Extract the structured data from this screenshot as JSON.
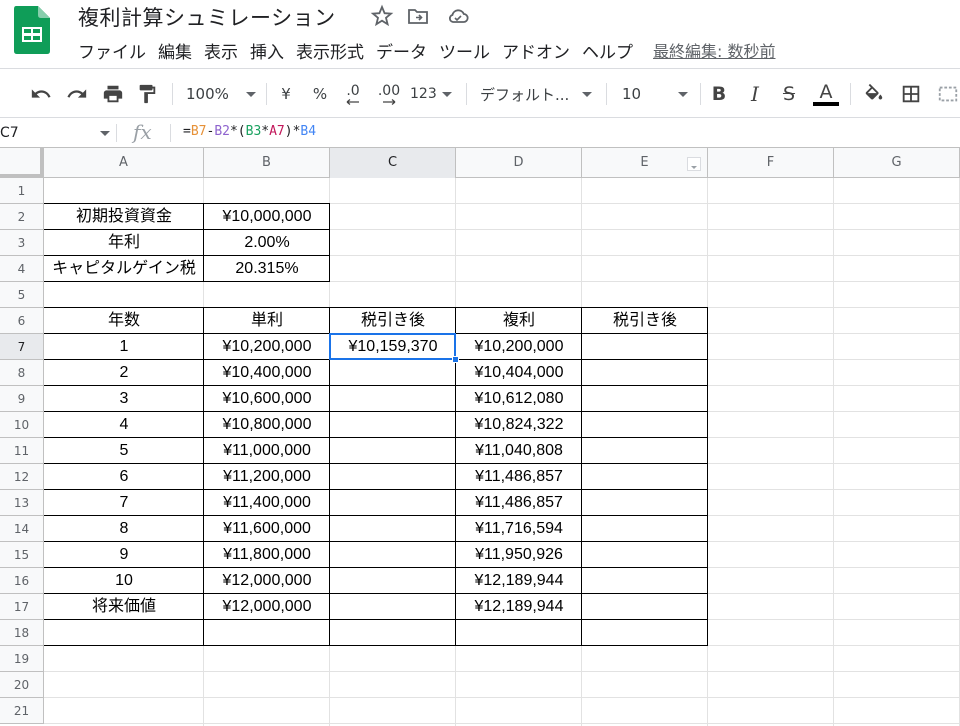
{
  "header": {
    "title": "複利計算シュミレーション",
    "menu": [
      "ファイル",
      "編集",
      "表示",
      "挿入",
      "表示形式",
      "データ",
      "ツール",
      "アドオン",
      "ヘルプ"
    ],
    "last_edit": "最終編集: 数秒前"
  },
  "toolbar": {
    "zoom": "100%",
    "currency": "¥",
    "percent": "%",
    "decimal_decrease": ".0",
    "decimal_increase": ".00",
    "more_formats": "123",
    "font": "デフォルト...",
    "font_size": "10",
    "bold": "B",
    "italic": "I",
    "strike": "S",
    "text_color": "A"
  },
  "formula_bar": {
    "cell_ref": "C7",
    "fx": "fx",
    "formula_parts": [
      {
        "text": "=",
        "color": "#202124"
      },
      {
        "text": "B7",
        "color": "#e69138"
      },
      {
        "text": "-",
        "color": "#202124"
      },
      {
        "text": "B2",
        "color": "#8e63ce"
      },
      {
        "text": "*(",
        "color": "#202124"
      },
      {
        "text": "B3",
        "color": "#1aa260"
      },
      {
        "text": "*",
        "color": "#202124"
      },
      {
        "text": "A7",
        "color": "#c2185b"
      },
      {
        "text": ")*",
        "color": "#202124"
      },
      {
        "text": "B4",
        "color": "#4285f4"
      }
    ]
  },
  "grid": {
    "columns": [
      "A",
      "B",
      "C",
      "D",
      "E",
      "F",
      "G"
    ],
    "rows": [
      "1",
      "2",
      "3",
      "4",
      "5",
      "6",
      "7",
      "8",
      "9",
      "10",
      "11",
      "12",
      "13",
      "14",
      "15",
      "16",
      "17",
      "18",
      "19",
      "20",
      "21"
    ],
    "inputs": [
      {
        "label": "初期投資資金",
        "value": "¥10,000,000"
      },
      {
        "label": "年利",
        "value": "2.00%"
      },
      {
        "label": "キャピタルゲイン税",
        "value": "20.315%"
      }
    ],
    "table_headers": [
      "年数",
      "単利",
      "税引き後",
      "複利",
      "税引き後"
    ],
    "table_rows": [
      [
        "1",
        "¥10,200,000",
        "¥10,159,370",
        "¥10,200,000",
        ""
      ],
      [
        "2",
        "¥10,400,000",
        "",
        "¥10,404,000",
        ""
      ],
      [
        "3",
        "¥10,600,000",
        "",
        "¥10,612,080",
        ""
      ],
      [
        "4",
        "¥10,800,000",
        "",
        "¥10,824,322",
        ""
      ],
      [
        "5",
        "¥11,000,000",
        "",
        "¥11,040,808",
        ""
      ],
      [
        "6",
        "¥11,200,000",
        "",
        "¥11,486,857",
        ""
      ],
      [
        "7",
        "¥11,400,000",
        "",
        "¥11,486,857",
        ""
      ],
      [
        "8",
        "¥11,600,000",
        "",
        "¥11,716,594",
        ""
      ],
      [
        "9",
        "¥11,800,000",
        "",
        "¥11,950,926",
        ""
      ],
      [
        "10",
        "¥12,000,000",
        "",
        "¥12,189,944",
        ""
      ],
      [
        "将来価値",
        "¥12,000,000",
        "",
        "¥12,189,944",
        ""
      ],
      [
        "",
        "",
        "",
        "",
        ""
      ]
    ]
  }
}
